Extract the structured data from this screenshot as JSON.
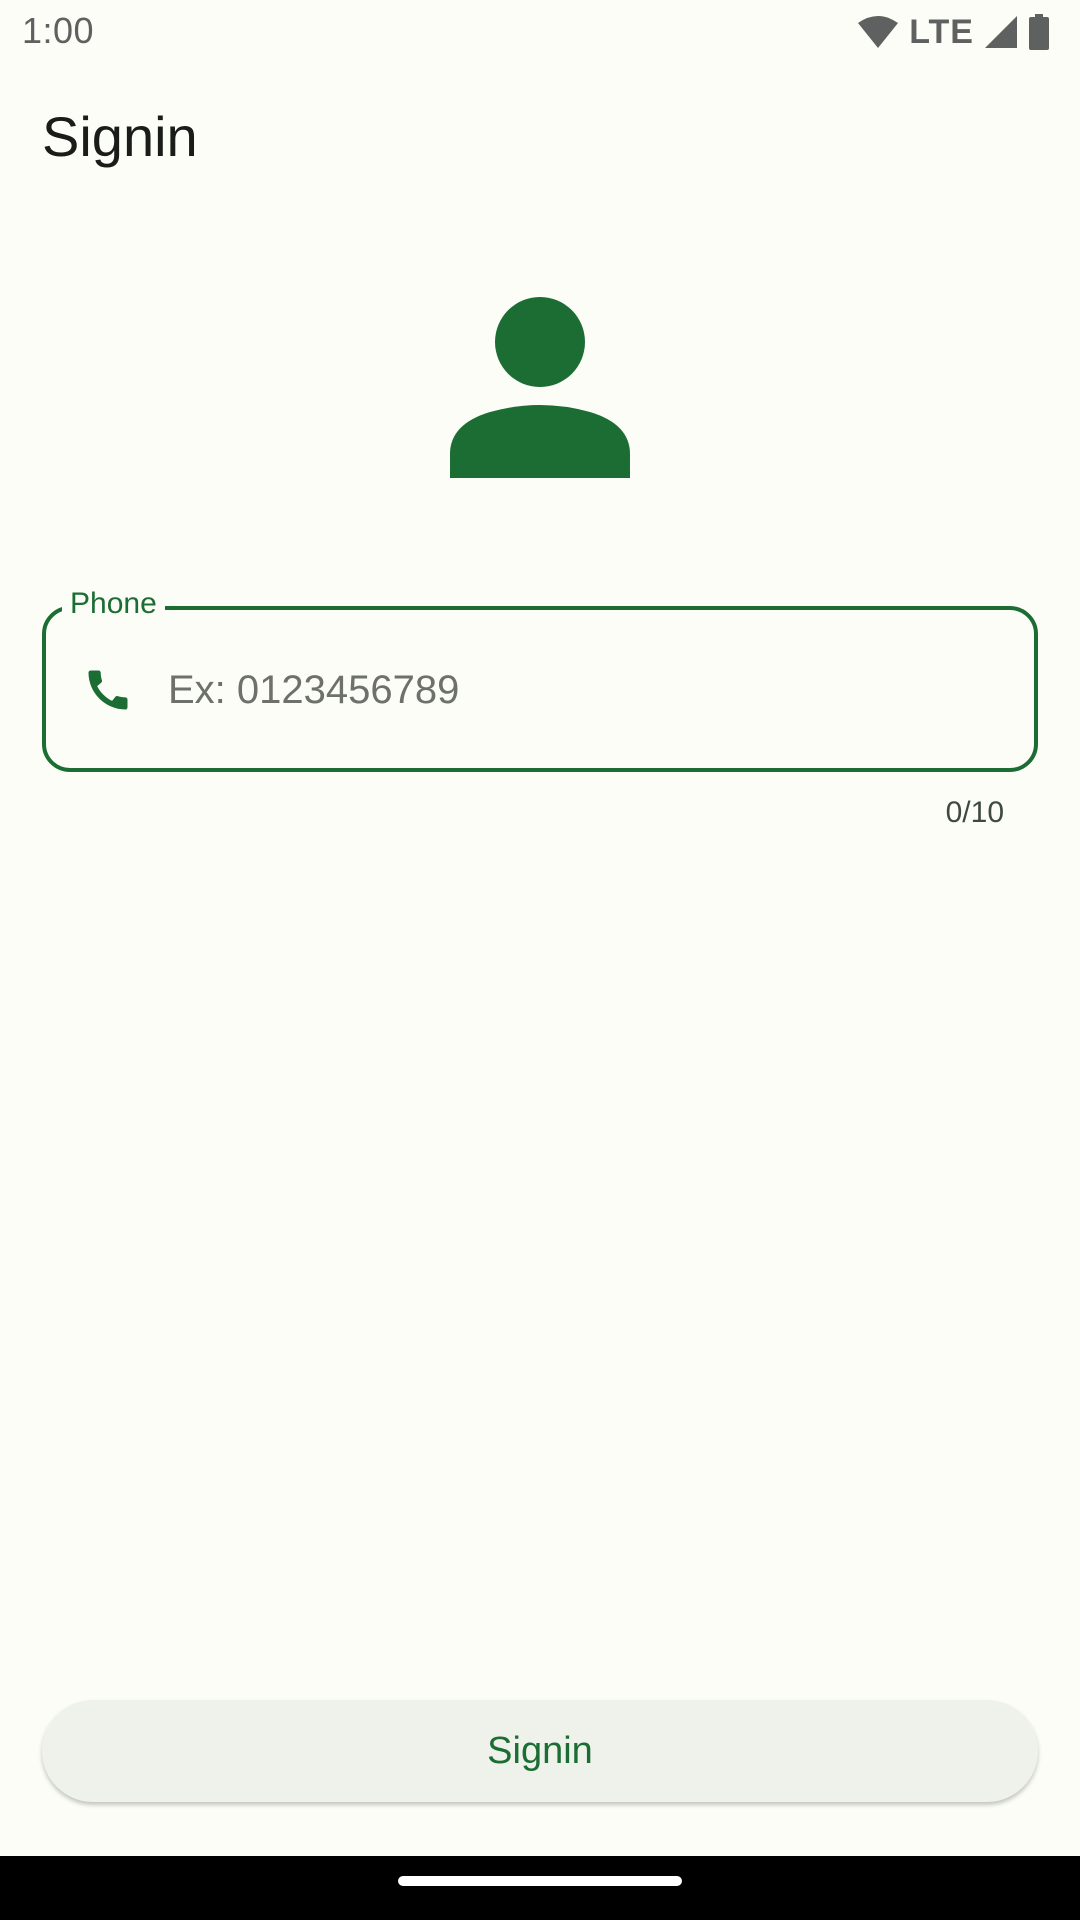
{
  "status_bar": {
    "time": "1:00",
    "network": "LTE",
    "icons": [
      "wifi-icon",
      "cellular-signal-icon",
      "battery-icon"
    ]
  },
  "header": {
    "title": "Signin"
  },
  "avatar": {
    "icon": "person-icon",
    "color": "#1b6d33"
  },
  "phone_field": {
    "label": "Phone",
    "placeholder": "Ex: 0123456789",
    "value": "",
    "icon": "phone-icon",
    "counter": "0/10"
  },
  "actions": {
    "signin_label": "Signin"
  },
  "colors": {
    "primary": "#1b6d33",
    "background": "#fcfdf7",
    "button_bg": "#eff2ea"
  }
}
